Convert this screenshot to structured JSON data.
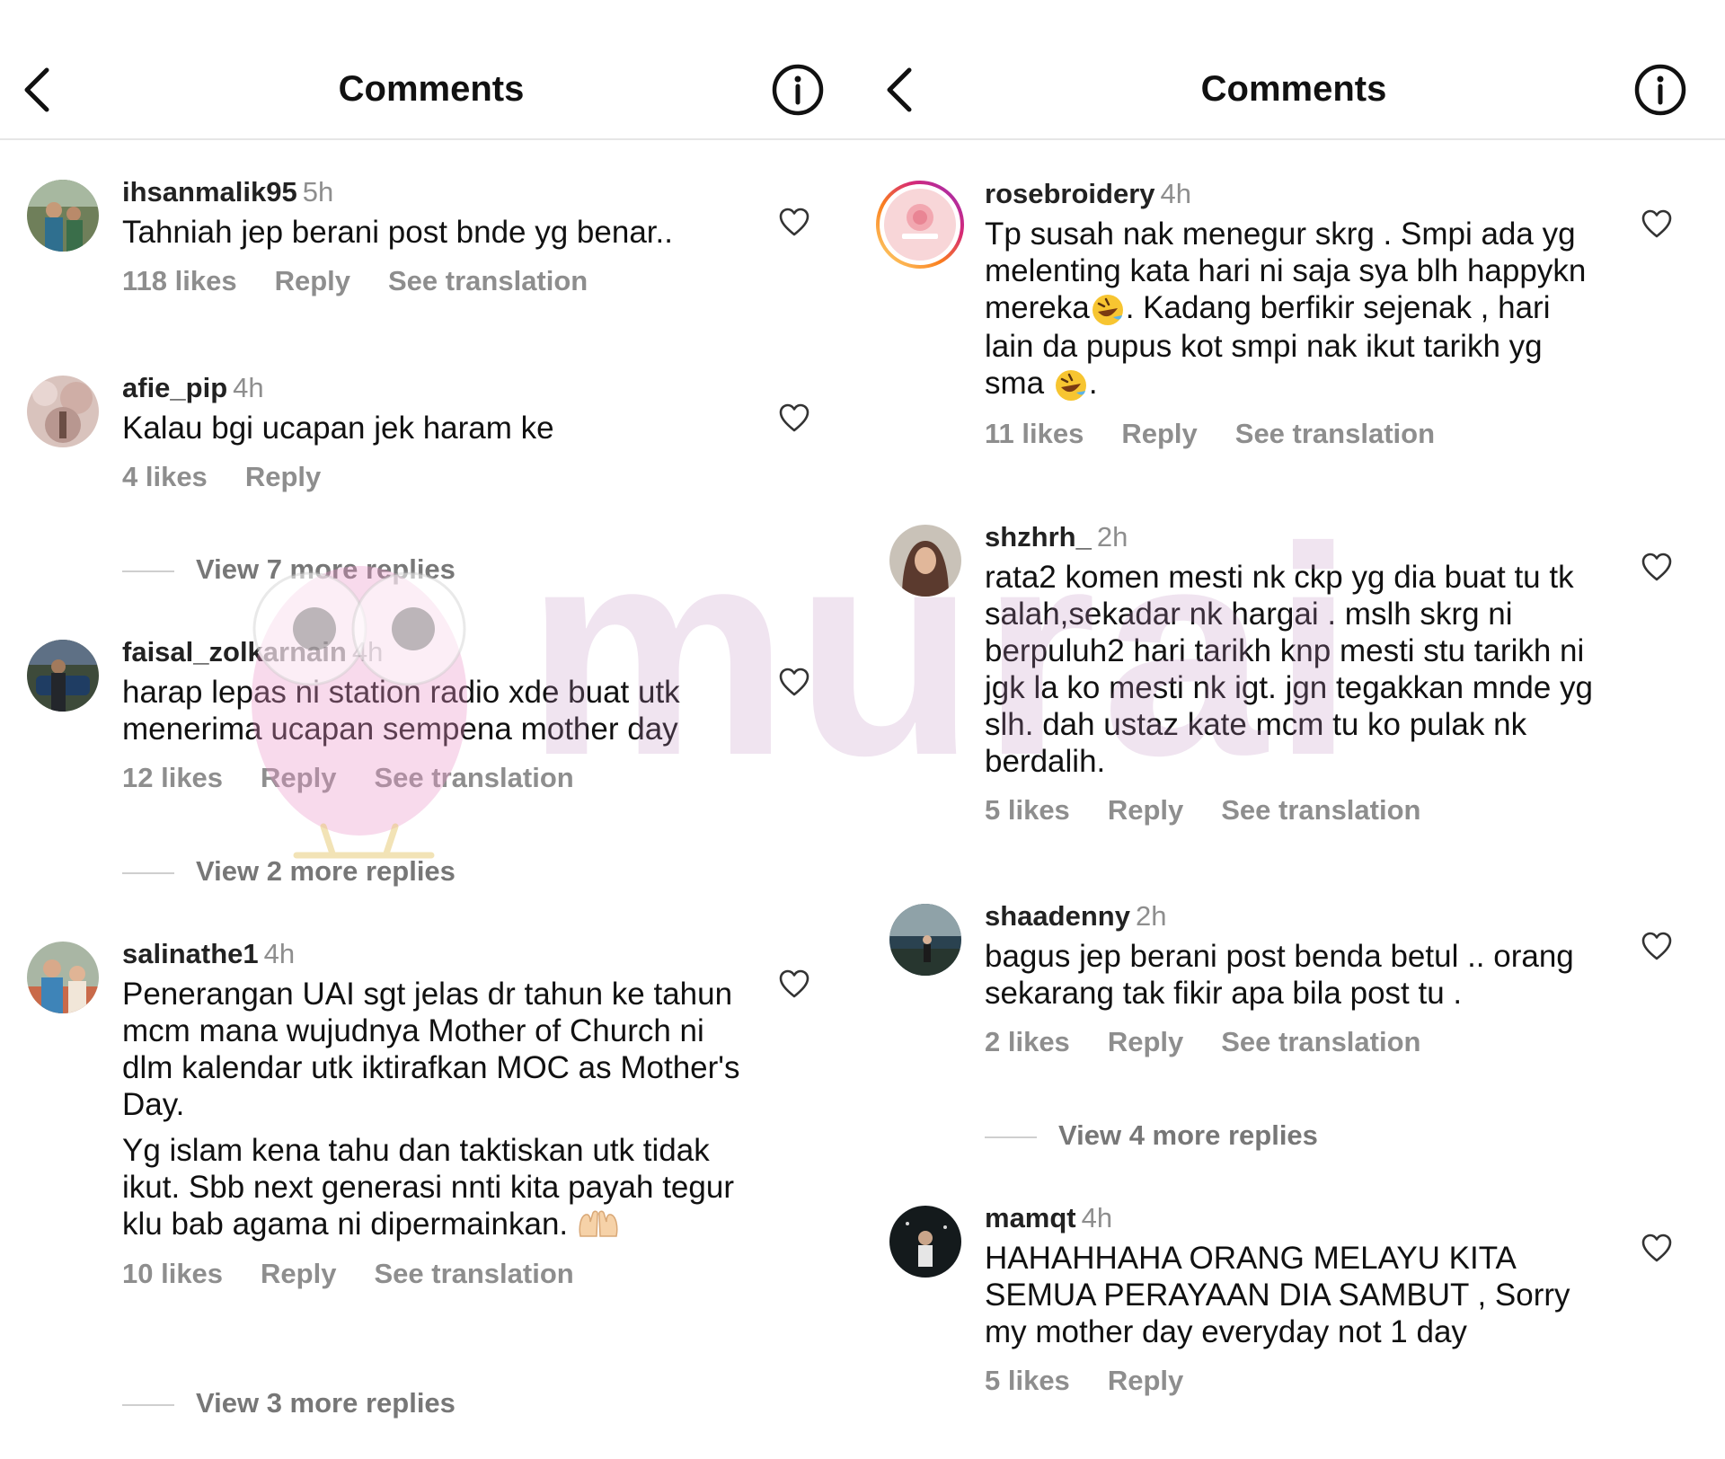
{
  "panels": [
    {
      "title": "Comments",
      "comments": [
        {
          "username": "ihsanmalik95",
          "time": "5h",
          "paragraphs": [
            "Tahniah jep berani post bnde yg benar.."
          ],
          "likes": "118 likes",
          "reply": "Reply",
          "translation": "See translation",
          "view_replies": ""
        },
        {
          "username": "afie_pip",
          "time": "4h",
          "paragraphs": [
            "Kalau bgi ucapan jek haram ke"
          ],
          "likes": "4 likes",
          "reply": "Reply",
          "translation": "",
          "view_replies": "View 7 more replies"
        },
        {
          "username": "faisal_zolkarnain",
          "time": "4h",
          "paragraphs": [
            "harap lepas ni station radio xde buat utk menerima ucapan sempena mother day"
          ],
          "likes": "12 likes",
          "reply": "Reply",
          "translation": "See translation",
          "view_replies": "View 2 more replies"
        },
        {
          "username": "salinathe1",
          "time": "4h",
          "paragraphs": [
            "Penerangan UAI sgt jelas dr tahun ke tahun mcm mana wujudnya Mother of Church ni dlm kalendar utk iktirafkan MOC as Mother's Day.",
            "Yg islam kena tahu dan taktiskan utk tidak ikut. Sbb next generasi nnti kita payah tegur klu bab agama ni dipermainkan."
          ],
          "likes": "10 likes",
          "reply": "Reply",
          "translation": "See translation",
          "view_replies": "View 3 more replies"
        }
      ]
    },
    {
      "title": "Comments",
      "comments": [
        {
          "username": "rosebroidery",
          "time": "4h",
          "paragraphs": [
            "Tp susah nak menegur skrg . Smpi ada yg melenting kata hari ni saja sya blh happykn mereka",
            ". Kadang berfikir sejenak , hari lain da pupus kot smpi nak ikut tarikh yg sma",
            "."
          ],
          "likes": "11 likes",
          "reply": "Reply",
          "translation": "See translation",
          "view_replies": ""
        },
        {
          "username": "shzhrh_",
          "time": "2h",
          "paragraphs": [
            "rata2 komen mesti nk ckp yg dia buat tu tk salah,sekadar nk hargai . mslh skrg ni berpuluh2 hari tarikh knp mesti stu tarikh ni jgk la ko mesti nk igt. jgn tegakkan mnde yg slh. dah ustaz kate mcm tu ko pulak nk berdalih."
          ],
          "likes": "5 likes",
          "reply": "Reply",
          "translation": "See translation",
          "view_replies": ""
        },
        {
          "username": "shaadenny",
          "time": "2h",
          "paragraphs": [
            "bagus jep berani post benda betul .. orang sekarang tak fikir apa bila post tu ."
          ],
          "likes": "2 likes",
          "reply": "Reply",
          "translation": "See translation",
          "view_replies": "View 4 more replies"
        },
        {
          "username": "mamqt",
          "time": "4h",
          "paragraphs": [
            "HAHAHHAHA ORANG MELAYU KITA SEMUA PERAYAAN DIA SAMBUT , Sorry my mother day everyday not 1 day"
          ],
          "likes": "5 likes",
          "reply": "Reply",
          "translation": "",
          "view_replies": ""
        }
      ]
    }
  ],
  "watermark": "murai",
  "icons": {
    "back": "chevron-left-icon",
    "info": "info-circle-icon",
    "heart": "heart-outline-icon",
    "emoji_laugh": "rolling-on-floor-laughing-emoji",
    "emoji_hands": "palms-up-together-emoji"
  },
  "colors": {
    "text": "#111111",
    "muted": "#8e8e8e",
    "divider": "#e6e6e6",
    "story_ring": "#e1306c"
  }
}
